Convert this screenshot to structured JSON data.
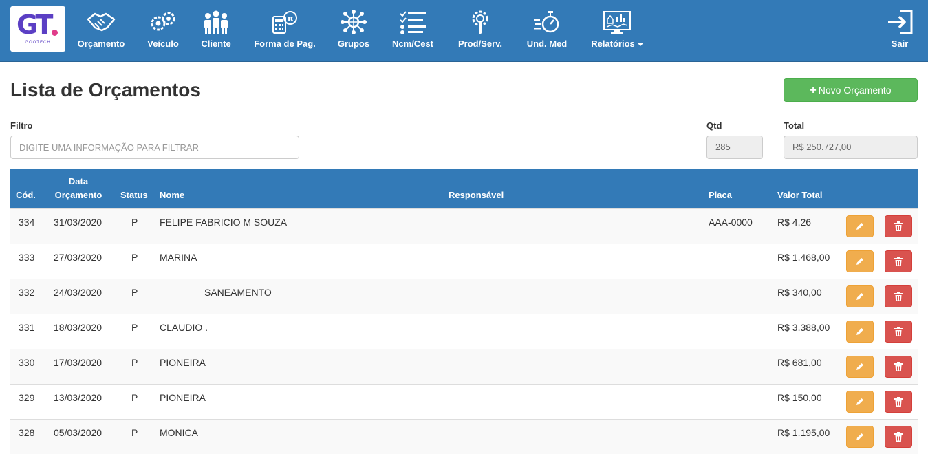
{
  "logo": {
    "text": "GT",
    "subtext": "GOOTECH"
  },
  "nav": [
    {
      "label": "Orçamento",
      "icon": "handshake-icon"
    },
    {
      "label": "Veículo",
      "icon": "gears-icon"
    },
    {
      "label": "Cliente",
      "icon": "users-icon"
    },
    {
      "label": "Forma de Pag.",
      "icon": "calculator-icon"
    },
    {
      "label": "Grupos",
      "icon": "network-icon"
    },
    {
      "label": "Ncm/Cest",
      "icon": "checklist-icon"
    },
    {
      "label": "Prod/Serv.",
      "icon": "wrench-gear-icon"
    },
    {
      "label": "Und. Med",
      "icon": "stopwatch-icon"
    },
    {
      "label": "Relatórios",
      "icon": "dashboard-icon"
    }
  ],
  "logout": {
    "label": "Sair",
    "icon": "sign-out-icon"
  },
  "page": {
    "title": "Lista de Orçamentos",
    "new_button": "Novo Orçamento"
  },
  "filter": {
    "label": "Filtro",
    "placeholder": "DIGITE UMA INFORMAÇÃO PARA FILTRAR",
    "qtd_label": "Qtd",
    "qtd_value": "285",
    "total_label": "Total",
    "total_value": "R$ 250.727,00"
  },
  "table": {
    "headers": {
      "cod": "Cód.",
      "data_line1": "Data",
      "data_line2": "Orçamento",
      "status": "Status",
      "nome": "Nome",
      "responsavel": "Responsável",
      "placa": "Placa",
      "valor": "Valor Total"
    },
    "rows": [
      {
        "cod": "334",
        "data": "31/03/2020",
        "status": "P",
        "nome": "FELIPE FABRICIO M SOUZA",
        "responsavel": "",
        "placa": "AAA-0000",
        "valor": "R$ 4,26"
      },
      {
        "cod": "333",
        "data": "27/03/2020",
        "status": "P",
        "nome": "MARINA",
        "responsavel": "",
        "placa": "",
        "valor": "R$ 1.468,00"
      },
      {
        "cod": "332",
        "data": "24/03/2020",
        "status": "P",
        "nome": "SANEAMENTO",
        "responsavel": "",
        "placa": "",
        "valor": "R$ 340,00"
      },
      {
        "cod": "331",
        "data": "18/03/2020",
        "status": "P",
        "nome": "CLAUDIO .",
        "responsavel": "",
        "placa": "",
        "valor": "R$ 3.388,00"
      },
      {
        "cod": "330",
        "data": "17/03/2020",
        "status": "P",
        "nome": "PIONEIRA",
        "responsavel": "",
        "placa": "",
        "valor": "R$ 681,00"
      },
      {
        "cod": "329",
        "data": "13/03/2020",
        "status": "P",
        "nome": "PIONEIRA",
        "responsavel": "",
        "placa": "",
        "valor": "R$ 150,00"
      },
      {
        "cod": "328",
        "data": "05/03/2020",
        "status": "P",
        "nome": "MONICA",
        "responsavel": "",
        "placa": "",
        "valor": "R$ 1.195,00"
      }
    ]
  },
  "colors": {
    "navbar": "#337ab7",
    "success": "#5cb85c",
    "warning": "#f0ad4e",
    "danger": "#d9534f"
  }
}
